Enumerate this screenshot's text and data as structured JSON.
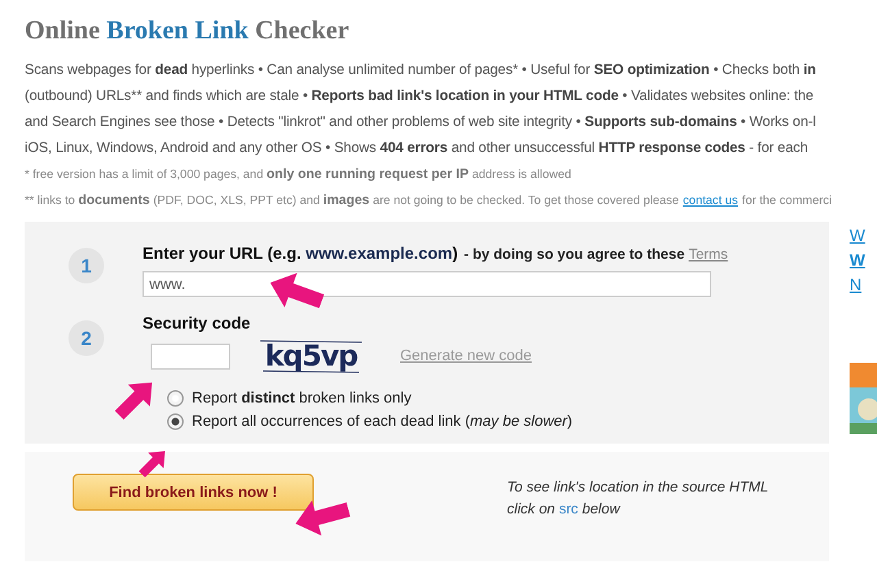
{
  "title": [
    {
      "text": "Online ",
      "highlight": false
    },
    {
      "text": "Broken Link",
      "highlight": true
    },
    {
      "text": " Checker",
      "highlight": false
    }
  ],
  "description": [
    "Scans webpages for **dead** hyperlinks • Can analyse unlimited number of pages* • Useful for **SEO optimization** • Checks both **in**",
    "(outbound) URLs** and finds which are stale • **Reports bad link's location in your HTML code** • Validates websites online: the",
    "and Search Engines see those • Detects \"linkrot\" and other problems of web site integrity • **Supports sub-domains** • Works on-l",
    "iOS, Linux, Windows, Android and any other OS • Shows **404 errors** and other unsuccessful **HTTP response codes** - for each"
  ],
  "footnotes": [
    [
      {
        "kind": "text",
        "text": "*  free version has a limit of 3,000 pages, and **only one running request per IP** address is allowed"
      }
    ],
    [
      {
        "kind": "text",
        "text": "** links to **documents** (PDF, DOC, XLS, PPT etc) and **images** are not going to be checked. To get those covered please"
      },
      {
        "kind": "link",
        "text": "contact us"
      },
      {
        "kind": "text",
        "text": "for the commerci"
      }
    ]
  ],
  "form": {
    "url_step": {
      "number": "1",
      "label": "Enter your URL (e.g. **www.example.com**)",
      "hint": "- by doing so you agree to these",
      "terms": "Terms",
      "value": "www."
    },
    "code_step": {
      "number": "2",
      "label": "Security code",
      "captcha": "kq5vp",
      "regenerate": "Generate new code"
    },
    "options": [
      {
        "label": "Report **distinct** broken links only",
        "selected": false
      },
      {
        "label": "Report all occurrences of each dead link (*may be slower*)",
        "selected": true
      }
    ],
    "button": "Find broken links now !",
    "note": {
      "line_1": "To see link's location in the source HTML",
      "before": "click on",
      "code": "src",
      "after": "below"
    }
  },
  "sidebar": {
    "links": [
      {
        "text": "W",
        "bold": false
      },
      {
        "text": "W",
        "bold": true
      },
      {
        "text": "N",
        "bold": false
      }
    ]
  }
}
